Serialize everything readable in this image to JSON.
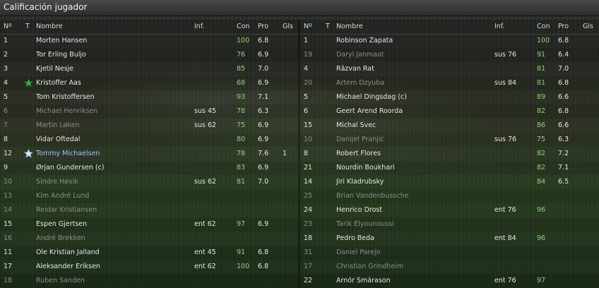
{
  "window": {
    "title": "Calificación jugador"
  },
  "columns": {
    "num": "Nº",
    "t": "T",
    "name": "Nombre",
    "inf": "Inf.",
    "con": "Con",
    "pro": "Pro",
    "gls": "Gls"
  },
  "left_team": {
    "players": [
      {
        "num": "1",
        "name": "Morten Hansen",
        "inf": "",
        "con": "100",
        "pro": "6.8",
        "gls": "",
        "state": "normal",
        "icon": ""
      },
      {
        "num": "2",
        "name": "Tor Erling Buljo",
        "inf": "",
        "con": "76",
        "pro": "6.9",
        "gls": "",
        "state": "normal",
        "icon": ""
      },
      {
        "num": "3",
        "name": "Kjetil Nesje",
        "inf": "",
        "con": "85",
        "pro": "7.0",
        "gls": "",
        "state": "normal",
        "icon": ""
      },
      {
        "num": "4",
        "name": "Kristoffer Aas",
        "inf": "",
        "con": "68",
        "pro": "6.9",
        "gls": "",
        "state": "normal",
        "icon": "green-star-icon"
      },
      {
        "num": "5",
        "name": "Tom Kristoffersen",
        "inf": "",
        "con": "93",
        "pro": "7.1",
        "gls": "",
        "state": "normal",
        "icon": ""
      },
      {
        "num": "6",
        "name": "Michael Henriksen",
        "inf": "sus 45",
        "con": "78",
        "pro": "6.3",
        "gls": "",
        "state": "dim",
        "icon": ""
      },
      {
        "num": "7",
        "name": "Martin Løken",
        "inf": "sus 62",
        "con": "75",
        "pro": "6.9",
        "gls": "",
        "state": "dim",
        "icon": ""
      },
      {
        "num": "8",
        "name": "Vidar Oftedal",
        "inf": "",
        "con": "80",
        "pro": "6.9",
        "gls": "",
        "state": "normal",
        "icon": ""
      },
      {
        "num": "12",
        "name": "Tommy Michaelsen",
        "inf": "",
        "con": "78",
        "pro": "7.6",
        "gls": "1",
        "state": "highlight",
        "icon": "white-star-icon"
      },
      {
        "num": "9",
        "name": "Ørjan Gundersen (c)",
        "inf": "",
        "con": "83",
        "pro": "6.9",
        "gls": "",
        "state": "normal",
        "icon": ""
      },
      {
        "num": "10",
        "name": "Sindre Høvik",
        "inf": "sus 62",
        "con": "81",
        "pro": "7.0",
        "gls": "",
        "state": "dim",
        "icon": ""
      },
      {
        "num": "13",
        "name": "Kim André Lund",
        "inf": "",
        "con": "",
        "pro": "",
        "gls": "",
        "state": "dim",
        "icon": ""
      },
      {
        "num": "14",
        "name": "Reidar Kristiansen",
        "inf": "",
        "con": "",
        "pro": "",
        "gls": "",
        "state": "dim",
        "icon": ""
      },
      {
        "num": "15",
        "name": "Espen Gjertsen",
        "inf": "ent 62",
        "con": "97",
        "pro": "6.9",
        "gls": "",
        "state": "normal",
        "icon": ""
      },
      {
        "num": "16",
        "name": "André Brekken",
        "inf": "",
        "con": "",
        "pro": "",
        "gls": "",
        "state": "dim",
        "icon": ""
      },
      {
        "num": "11",
        "name": "Ole Kristian Jalland",
        "inf": "ent 45",
        "con": "91",
        "pro": "6.8",
        "gls": "",
        "state": "normal",
        "icon": ""
      },
      {
        "num": "17",
        "name": "Aleksander Eriksen",
        "inf": "ent 62",
        "con": "100",
        "pro": "6.8",
        "gls": "",
        "state": "normal",
        "icon": ""
      },
      {
        "num": "18",
        "name": "Ruben Sanden",
        "inf": "",
        "con": "",
        "pro": "",
        "gls": "",
        "state": "dim",
        "icon": ""
      }
    ]
  },
  "right_team": {
    "players": [
      {
        "num": "1",
        "name": "Robinson Zapata",
        "inf": "",
        "con": "100",
        "pro": "6.8",
        "gls": "",
        "state": "normal",
        "icon": ""
      },
      {
        "num": "19",
        "name": "Daryl Janmaat",
        "inf": "sus 76",
        "con": "91",
        "pro": "6.4",
        "gls": "",
        "state": "dim",
        "icon": ""
      },
      {
        "num": "4",
        "name": "Răzvan Rat",
        "inf": "",
        "con": "81",
        "pro": "7.0",
        "gls": "",
        "state": "normal",
        "icon": ""
      },
      {
        "num": "20",
        "name": "Artem Dzyuba",
        "inf": "sus 84",
        "con": "81",
        "pro": "6.8",
        "gls": "",
        "state": "dim",
        "icon": ""
      },
      {
        "num": "5",
        "name": "Michael Dingsdag (c)",
        "inf": "",
        "con": "89",
        "pro": "6.6",
        "gls": "",
        "state": "normal",
        "icon": ""
      },
      {
        "num": "6",
        "name": "Geert Arend Roorda",
        "inf": "",
        "con": "82",
        "pro": "6.8",
        "gls": "",
        "state": "normal",
        "icon": ""
      },
      {
        "num": "15",
        "name": "Michal Svec",
        "inf": "",
        "con": "86",
        "pro": "6.6",
        "gls": "",
        "state": "normal",
        "icon": ""
      },
      {
        "num": "10",
        "name": "Danijel Pranjic",
        "inf": "sus 76",
        "con": "75",
        "pro": "6.3",
        "gls": "",
        "state": "dim",
        "icon": ""
      },
      {
        "num": "8",
        "name": "Robert Flores",
        "inf": "",
        "con": "82",
        "pro": "7.2",
        "gls": "",
        "state": "normal",
        "icon": ""
      },
      {
        "num": "21",
        "name": "Nourdin Boukhari",
        "inf": "",
        "con": "82",
        "pro": "7.1",
        "gls": "",
        "state": "normal",
        "icon": ""
      },
      {
        "num": "14",
        "name": "Jiri Kladrubsky",
        "inf": "",
        "con": "84",
        "pro": "6.5",
        "gls": "",
        "state": "normal",
        "icon": ""
      },
      {
        "num": "25",
        "name": "Brian Vandenbussche",
        "inf": "",
        "con": "",
        "pro": "",
        "gls": "",
        "state": "dim",
        "icon": ""
      },
      {
        "num": "24",
        "name": "Henrico Drost",
        "inf": "ent 76",
        "con": "96",
        "pro": "",
        "gls": "",
        "state": "normal",
        "icon": ""
      },
      {
        "num": "23",
        "name": "Tarik Elyounoussi",
        "inf": "",
        "con": "",
        "pro": "",
        "gls": "",
        "state": "dim",
        "icon": ""
      },
      {
        "num": "18",
        "name": "Pedro Beda",
        "inf": "ent 84",
        "con": "96",
        "pro": "",
        "gls": "",
        "state": "normal",
        "icon": ""
      },
      {
        "num": "31",
        "name": "Daniel Parejo",
        "inf": "",
        "con": "",
        "pro": "",
        "gls": "",
        "state": "dim",
        "icon": ""
      },
      {
        "num": "17",
        "name": "Christian Grindheim",
        "inf": "",
        "con": "",
        "pro": "",
        "gls": "",
        "state": "dim",
        "icon": ""
      },
      {
        "num": "22",
        "name": "Arnór Smárason",
        "inf": "ent 76",
        "con": "97",
        "pro": "",
        "gls": "",
        "state": "normal",
        "icon": ""
      }
    ]
  },
  "colors": {
    "condition": "#8fd17a",
    "highlight_name": "#9cc0ff",
    "dim_text": "#8c8c8c"
  }
}
